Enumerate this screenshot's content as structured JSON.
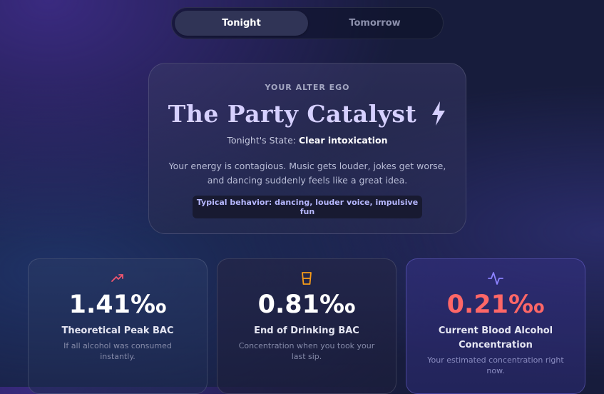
{
  "toggle": {
    "options": [
      "Tonight",
      "Tomorrow"
    ],
    "selected": "Tonight"
  },
  "alter_ego": {
    "kicker": "YOUR ALTER EGO",
    "title": "The Party Catalyst",
    "title_icon": "lightning-bolt-icon",
    "state_prefix": "Tonight's State:",
    "state_value": "Clear intoxication",
    "description": "Your energy is contagious. Music gets louder, jokes get worse, and dancing suddenly feels like a great idea.",
    "behavior": "Typical behavior: dancing, louder voice, impulsive fun",
    "title_color": "#d6d0ff"
  },
  "stats": [
    {
      "icon": "trending-up-icon",
      "icon_color": "#f0566e",
      "value": "1.41‰",
      "label": "Theoretical Peak BAC",
      "sub": "If all alcohol was consumed instantly."
    },
    {
      "icon": "glass-icon",
      "icon_color": "#f59a18",
      "value": "0.81‰",
      "label": "End of Drinking BAC",
      "sub": "Concentration when you took your last sip."
    },
    {
      "icon": "pulse-icon",
      "icon_color": "#8c82ff",
      "value": "0.21‰",
      "value_color": "#ff6767",
      "label": "Current Blood Alcohol Concentration",
      "sub": "Your estimated concentration right now."
    }
  ]
}
